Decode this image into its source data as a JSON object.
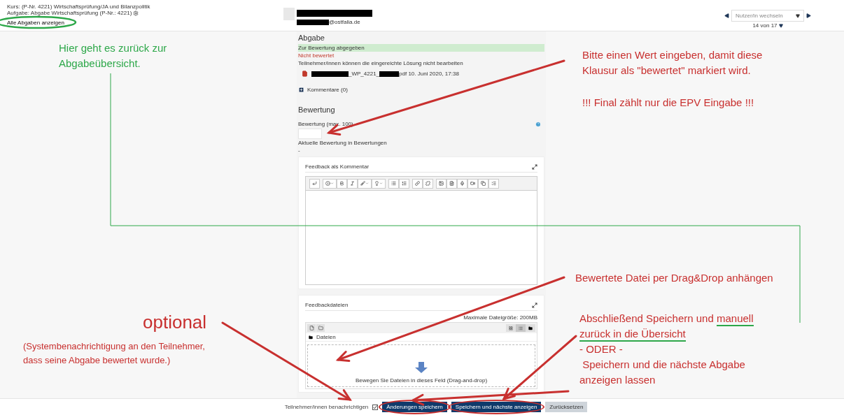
{
  "breadcrumb": {
    "course": "Kurs: (P-Nr. 4221) Wirtschaftsprüfung/JA und Bilanzpolitik",
    "assignment": "Aufgabe: Abgabe Wirtschaftsprüfung (P-Nr.: 4221)",
    "link": "Alle Abgaben anzeigen"
  },
  "user": {
    "email_suffix": "@ostfalia.de"
  },
  "user_switcher": {
    "placeholder": "Nutzer/in wechseln",
    "count": "14 von 17"
  },
  "submission": {
    "heading": "Abgabe",
    "status": "Zur Bewertung abgegeben",
    "grading_status": "Nicht bewertet",
    "edit_note": "Teilnehmer/innen können die eingereichte Lösung nicht bearbeiten",
    "file_middle": "_WP_4221_",
    "file_end": "pdf 10. Juni 2020, 17:38",
    "comments": "Kommentare (0)"
  },
  "grade": {
    "heading": "Bewertung",
    "label": "Bewertung (max. 100)",
    "current_label": "Aktuelle Bewertung in Bewertungen",
    "current_value": "-"
  },
  "feedback_comment": {
    "title": "Feedback als Kommentar"
  },
  "feedback_files": {
    "title": "Feedbackdateien",
    "max_size": "Maximale Dateigröße: 200MB",
    "folder": "Dateien",
    "drop_hint": "Bewegen Sie Dateien in dieses Feld (Drag-and-drop)"
  },
  "footer": {
    "notify_label": "Teilnehmer/innen benachrichtigen",
    "notify_checked": true,
    "buttons": [
      {
        "label": "Änderungen speichern",
        "kind": "primary"
      },
      {
        "label": "Speichern und nächste anzeigen",
        "kind": "primary"
      },
      {
        "label": "Zurücksetzen",
        "kind": "secondary"
      }
    ]
  },
  "annotations": [
    {
      "kind": "note",
      "color": "#2ea84a",
      "lines": [
        [
          {
            "text": "Hier geht es zurück zur",
            "underlined": false
          }
        ],
        [
          {
            "text": "Abgabeübersicht.",
            "underlined": false
          }
        ]
      ]
    },
    {
      "kind": "note",
      "color": "#c8302f",
      "lines": [
        [
          {
            "text": "Bitte einen Wert eingeben, damit diese",
            "underlined": false
          }
        ],
        [
          {
            "text": "Klausur als \"bewertet\" markiert wird.",
            "underlined": false
          }
        ]
      ]
    },
    {
      "kind": "note",
      "color": "#c8302f",
      "lines": [
        [
          {
            "text": "!!! Final zählt nur die EPV Eingabe !!!",
            "underlined": false
          }
        ]
      ]
    },
    {
      "kind": "note",
      "color": "#c8302f",
      "lines": [
        [
          {
            "text": "Bewertete Datei per Drag&Drop anhängen",
            "underlined": false
          }
        ]
      ]
    },
    {
      "kind": "title",
      "color": "#c8302f",
      "lines": [
        [
          {
            "text": "optional",
            "underlined": false
          }
        ]
      ]
    },
    {
      "kind": "small",
      "color": "#c8302f",
      "lines": [
        [
          {
            "text": "(Systembenachrichtigung an den Teilnehmer,",
            "underlined": false
          }
        ],
        [
          {
            "text": "dass seine Abgabe bewertet wurde.)",
            "underlined": false
          }
        ]
      ]
    },
    {
      "kind": "note",
      "color": "#c8302f",
      "lines": [
        [
          {
            "text": "Abschließend Speichern und ",
            "underlined": false
          },
          {
            "text": "manuell",
            "underlined": true
          }
        ],
        [
          {
            "text": "zurück in die Übersicht",
            "underlined": true
          }
        ],
        [
          {
            "text": "- ODER -",
            "underlined": false
          }
        ],
        [
          {
            "text": " Speichern und die nächste Abgabe",
            "underlined": false
          }
        ],
        [
          {
            "text": "anzeigen lassen",
            "underlined": false
          }
        ]
      ]
    }
  ]
}
